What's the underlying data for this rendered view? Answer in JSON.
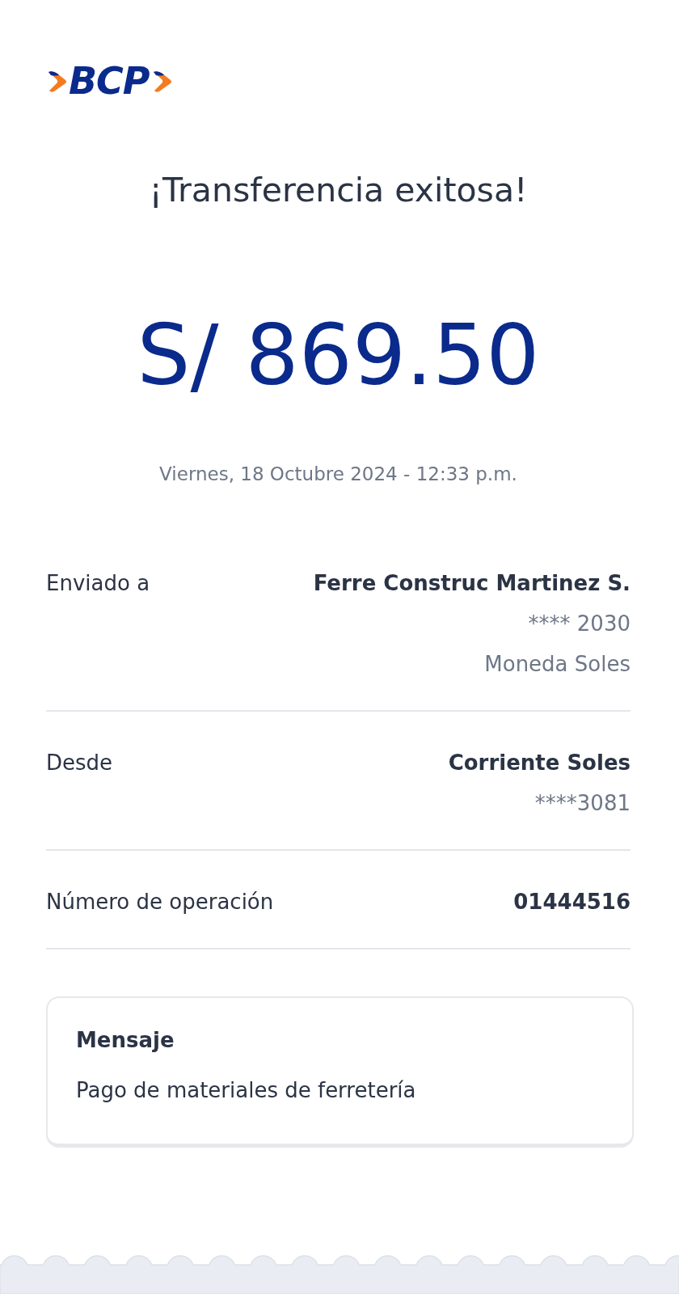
{
  "logo": {
    "text": "BCP"
  },
  "title": "¡Transferencia exitosa!",
  "amount": "S/ 869.50",
  "datetime": "Viernes, 18 Octubre 2024 - 12:33 p.m.",
  "details": [
    {
      "label": "Enviado a",
      "values": [
        {
          "text": "Ferre Construc Martinez S.",
          "kind": "primary"
        },
        {
          "text": "**** 2030",
          "kind": "secondary"
        },
        {
          "text": "Moneda Soles",
          "kind": "secondary"
        }
      ]
    },
    {
      "label": "Desde",
      "values": [
        {
          "text": "Corriente Soles",
          "kind": "primary"
        },
        {
          "text": "****3081",
          "kind": "secondary"
        }
      ]
    },
    {
      "label": "Número de operación",
      "values": [
        {
          "text": "01444516",
          "kind": "primary"
        }
      ]
    }
  ],
  "message": {
    "title": "Mensaje",
    "text": "Pago de materiales de ferretería"
  }
}
